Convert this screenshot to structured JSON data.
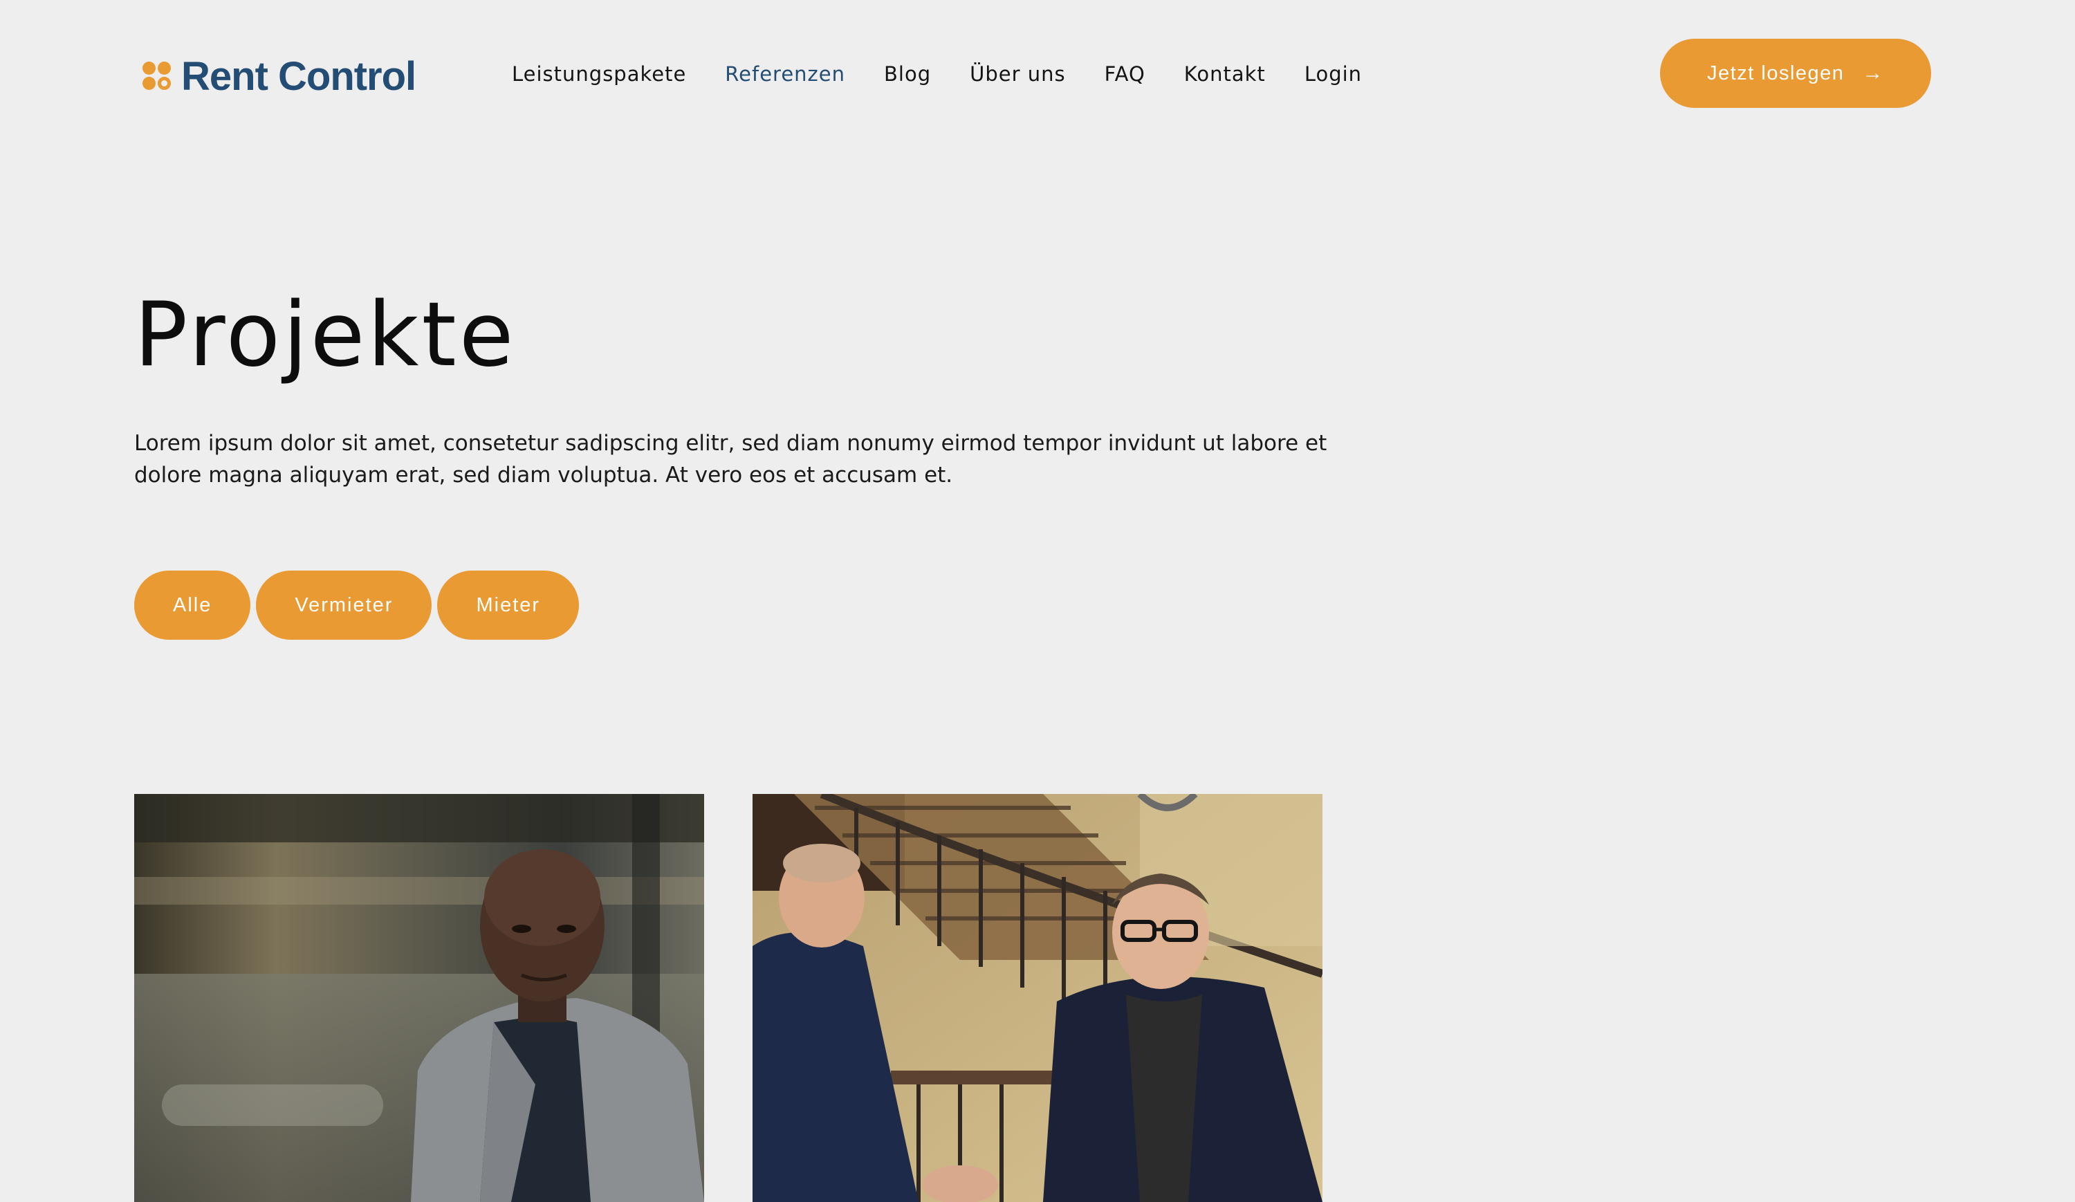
{
  "header": {
    "logo_text": "Rent Control",
    "nav": [
      {
        "label": "Leistungspakete"
      },
      {
        "label": "Referenzen",
        "active": true
      },
      {
        "label": "Blog"
      },
      {
        "label": "Über uns"
      },
      {
        "label": "FAQ"
      },
      {
        "label": "Kontakt"
      },
      {
        "label": "Login"
      }
    ],
    "cta_label": "Jetzt loslegen",
    "cta_icon": "arrow-right-icon"
  },
  "hero": {
    "title": "Projekte",
    "intro": "Lorem ipsum dolor sit amet, consetetur sadipscing elitr, sed diam nonumy eirmod tempor invidunt ut labore et dolore magna aliquyam erat, sed diam voluptua. At vero eos et accusam et."
  },
  "filters": [
    {
      "label": "Alle"
    },
    {
      "label": "Vermieter"
    },
    {
      "label": "Mieter"
    }
  ],
  "projects": [
    {
      "image": "portrait-man-in-grey-blazer-photo"
    },
    {
      "image": "two-men-shaking-hands-on-staircase-photo"
    }
  ],
  "colors": {
    "background": "#eeeeee",
    "accent": "#e99a33",
    "brand": "#234d74",
    "text": "#111111"
  }
}
